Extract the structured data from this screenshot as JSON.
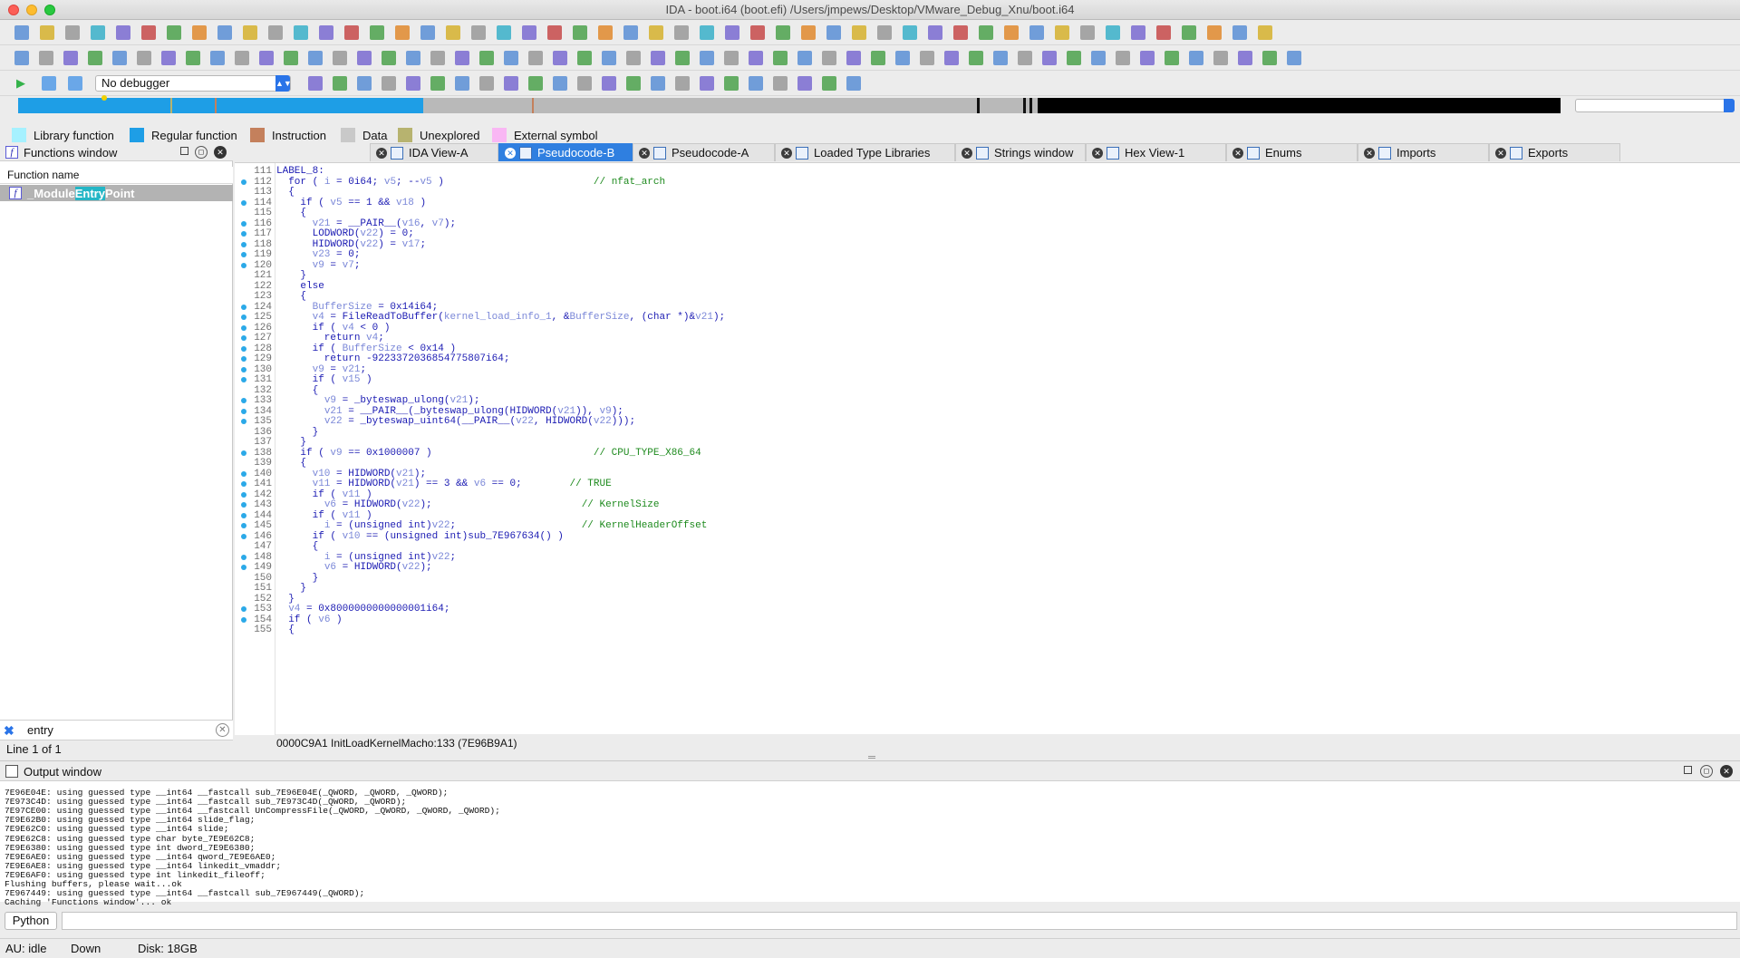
{
  "window": {
    "title": "IDA - boot.i64 (boot.efi) /Users/jmpews/Desktop/VMware_Debug_Xnu/boot.i64"
  },
  "debugger": {
    "selected": "No debugger"
  },
  "legend": [
    {
      "label": "Library function",
      "color": "#a6f1ff"
    },
    {
      "label": "Regular function",
      "color": "#1e9ee6"
    },
    {
      "label": "Instruction",
      "color": "#c4805c"
    },
    {
      "label": "Data",
      "color": "#c9c9c9"
    },
    {
      "label": "Unexplored",
      "color": "#b7b36f"
    },
    {
      "label": "External symbol",
      "color": "#f9b7f4"
    }
  ],
  "functions": {
    "title": "Functions window",
    "column": "Function name",
    "rows": [
      {
        "pre": "_Module",
        "match": "Entry",
        "post": "Point"
      }
    ],
    "filter": "entry",
    "status": "Line 1 of 1"
  },
  "tabs": [
    {
      "label": "IDA View-A",
      "active": false
    },
    {
      "label": "Pseudocode-B",
      "active": true
    },
    {
      "label": "Pseudocode-A",
      "active": false
    },
    {
      "label": "Loaded Type Libraries",
      "active": false
    },
    {
      "label": "Strings window",
      "active": false
    },
    {
      "label": "Hex View-1",
      "active": false
    },
    {
      "label": "Enums",
      "active": false
    },
    {
      "label": "Imports",
      "active": false
    },
    {
      "label": "Exports",
      "active": false
    }
  ],
  "code": {
    "lines": [
      {
        "n": "111",
        "bp": false,
        "t": "LABEL_8:"
      },
      {
        "n": "112",
        "bp": true,
        "t": "  for ( i = 0i64; v5; --v5 )                         // nfat_arch"
      },
      {
        "n": "113",
        "bp": false,
        "t": "  {"
      },
      {
        "n": "114",
        "bp": true,
        "t": "    if ( v5 == 1 && v18 )"
      },
      {
        "n": "115",
        "bp": false,
        "t": "    {"
      },
      {
        "n": "116",
        "bp": true,
        "t": "      v21 = __PAIR__(v16, v7);"
      },
      {
        "n": "117",
        "bp": true,
        "t": "      LODWORD(v22) = 0;"
      },
      {
        "n": "118",
        "bp": true,
        "t": "      HIDWORD(v22) = v17;"
      },
      {
        "n": "119",
        "bp": true,
        "t": "      v23 = 0;"
      },
      {
        "n": "120",
        "bp": true,
        "t": "      v9 = v7;"
      },
      {
        "n": "121",
        "bp": false,
        "t": "    }"
      },
      {
        "n": "122",
        "bp": false,
        "t": "    else"
      },
      {
        "n": "123",
        "bp": false,
        "t": "    {"
      },
      {
        "n": "124",
        "bp": true,
        "t": "      BufferSize = 0x14i64;"
      },
      {
        "n": "125",
        "bp": true,
        "t": "      v4 = FileReadToBuffer(kernel_load_info_1, &BufferSize, (char *)&v21);"
      },
      {
        "n": "126",
        "bp": true,
        "t": "      if ( v4 < 0 )"
      },
      {
        "n": "127",
        "bp": true,
        "t": "        return v4;"
      },
      {
        "n": "128",
        "bp": true,
        "t": "      if ( BufferSize < 0x14 )"
      },
      {
        "n": "129",
        "bp": true,
        "t": "        return -9223372036854775807i64;"
      },
      {
        "n": "130",
        "bp": true,
        "t": "      v9 = v21;"
      },
      {
        "n": "131",
        "bp": true,
        "t": "      if ( v15 )"
      },
      {
        "n": "132",
        "bp": false,
        "t": "      {"
      },
      {
        "n": "133",
        "bp": true,
        "t": "        v9 = _byteswap_ulong(v21);"
      },
      {
        "n": "134",
        "bp": true,
        "t": "        v21 = __PAIR__(_byteswap_ulong(HIDWORD(v21)), v9);"
      },
      {
        "n": "135",
        "bp": true,
        "t": "        v22 = _byteswap_uint64(__PAIR__(v22, HIDWORD(v22)));"
      },
      {
        "n": "136",
        "bp": false,
        "t": "      }"
      },
      {
        "n": "137",
        "bp": false,
        "t": "    }"
      },
      {
        "n": "138",
        "bp": true,
        "t": "    if ( v9 == 0x1000007 )                           // CPU_TYPE_X86_64"
      },
      {
        "n": "139",
        "bp": false,
        "t": "    {"
      },
      {
        "n": "140",
        "bp": true,
        "t": "      v10 = HIDWORD(v21);"
      },
      {
        "n": "141",
        "bp": true,
        "t": "      v11 = HIDWORD(v21) == 3 && v6 == 0;        // TRUE"
      },
      {
        "n": "142",
        "bp": true,
        "t": "      if ( v11 )"
      },
      {
        "n": "143",
        "bp": true,
        "t": "        v6 = HIDWORD(v22);                         // KernelSize"
      },
      {
        "n": "144",
        "bp": true,
        "t": "      if ( v11 )"
      },
      {
        "n": "145",
        "bp": true,
        "t": "        i = (unsigned int)v22;                     // KernelHeaderOffset"
      },
      {
        "n": "146",
        "bp": true,
        "t": "      if ( v10 == (unsigned int)sub_7E967634() )"
      },
      {
        "n": "147",
        "bp": false,
        "t": "      {"
      },
      {
        "n": "148",
        "bp": true,
        "t": "        i = (unsigned int)v22;"
      },
      {
        "n": "149",
        "bp": true,
        "t": "        v6 = HIDWORD(v22);"
      },
      {
        "n": "150",
        "bp": false,
        "t": "      }"
      },
      {
        "n": "151",
        "bp": false,
        "t": "    }"
      },
      {
        "n": "152",
        "bp": false,
        "t": "  }"
      },
      {
        "n": "153",
        "bp": true,
        "t": "  v4 = 0x8000000000000001i64;"
      },
      {
        "n": "154",
        "bp": true,
        "t": "  if ( v6 )"
      },
      {
        "n": "155",
        "bp": false,
        "t": "  {"
      }
    ],
    "status": "0000C9A1  InitLoadKernelMacho:133 (7E96B9A1)"
  },
  "output": {
    "title": "Output window",
    "lines": [
      "7E96E04E: using guessed type __int64 __fastcall sub_7E96E04E(_QWORD, _QWORD, _QWORD);",
      "7E973C4D: using guessed type __int64 __fastcall sub_7E973C4D(_QWORD, _QWORD);",
      "7E97CE00: using guessed type __int64 __fastcall UnCompressFile(_QWORD, _QWORD, _QWORD, _QWORD);",
      "7E9E62B0: using guessed type __int64 slide_flag;",
      "7E9E62C0: using guessed type __int64 slide;",
      "7E9E62C8: using guessed type char byte_7E9E62C8;",
      "7E9E6380: using guessed type int dword_7E9E6380;",
      "7E9E6AE0: using guessed type __int64 qword_7E9E6AE0;",
      "7E9E6AE8: using guessed type __int64 linkedit_vmaddr;",
      "7E9E6AF0: using guessed type int linkedit_fileoff;",
      "Flushing buffers, please wait...ok",
      "7E967449: using guessed type __int64 __fastcall sub_7E967449(_QWORD);",
      "Caching 'Functions window'... ok"
    ]
  },
  "python": {
    "label": "Python"
  },
  "status": {
    "au": "AU:  idle",
    "dir": "Down",
    "disk": "Disk: 18GB"
  }
}
